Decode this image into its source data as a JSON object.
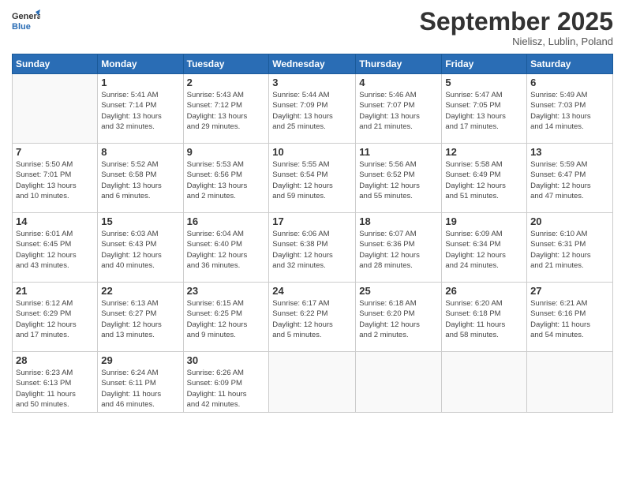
{
  "logo": {
    "line1": "General",
    "line2": "Blue"
  },
  "title": "September 2025",
  "subtitle": "Nielisz, Lublin, Poland",
  "weekdays": [
    "Sunday",
    "Monday",
    "Tuesday",
    "Wednesday",
    "Thursday",
    "Friday",
    "Saturday"
  ],
  "days": [
    {
      "date": "",
      "info": ""
    },
    {
      "date": "1",
      "info": "Sunrise: 5:41 AM\nSunset: 7:14 PM\nDaylight: 13 hours\nand 32 minutes."
    },
    {
      "date": "2",
      "info": "Sunrise: 5:43 AM\nSunset: 7:12 PM\nDaylight: 13 hours\nand 29 minutes."
    },
    {
      "date": "3",
      "info": "Sunrise: 5:44 AM\nSunset: 7:09 PM\nDaylight: 13 hours\nand 25 minutes."
    },
    {
      "date": "4",
      "info": "Sunrise: 5:46 AM\nSunset: 7:07 PM\nDaylight: 13 hours\nand 21 minutes."
    },
    {
      "date": "5",
      "info": "Sunrise: 5:47 AM\nSunset: 7:05 PM\nDaylight: 13 hours\nand 17 minutes."
    },
    {
      "date": "6",
      "info": "Sunrise: 5:49 AM\nSunset: 7:03 PM\nDaylight: 13 hours\nand 14 minutes."
    },
    {
      "date": "7",
      "info": "Sunrise: 5:50 AM\nSunset: 7:01 PM\nDaylight: 13 hours\nand 10 minutes."
    },
    {
      "date": "8",
      "info": "Sunrise: 5:52 AM\nSunset: 6:58 PM\nDaylight: 13 hours\nand 6 minutes."
    },
    {
      "date": "9",
      "info": "Sunrise: 5:53 AM\nSunset: 6:56 PM\nDaylight: 13 hours\nand 2 minutes."
    },
    {
      "date": "10",
      "info": "Sunrise: 5:55 AM\nSunset: 6:54 PM\nDaylight: 12 hours\nand 59 minutes."
    },
    {
      "date": "11",
      "info": "Sunrise: 5:56 AM\nSunset: 6:52 PM\nDaylight: 12 hours\nand 55 minutes."
    },
    {
      "date": "12",
      "info": "Sunrise: 5:58 AM\nSunset: 6:49 PM\nDaylight: 12 hours\nand 51 minutes."
    },
    {
      "date": "13",
      "info": "Sunrise: 5:59 AM\nSunset: 6:47 PM\nDaylight: 12 hours\nand 47 minutes."
    },
    {
      "date": "14",
      "info": "Sunrise: 6:01 AM\nSunset: 6:45 PM\nDaylight: 12 hours\nand 43 minutes."
    },
    {
      "date": "15",
      "info": "Sunrise: 6:03 AM\nSunset: 6:43 PM\nDaylight: 12 hours\nand 40 minutes."
    },
    {
      "date": "16",
      "info": "Sunrise: 6:04 AM\nSunset: 6:40 PM\nDaylight: 12 hours\nand 36 minutes."
    },
    {
      "date": "17",
      "info": "Sunrise: 6:06 AM\nSunset: 6:38 PM\nDaylight: 12 hours\nand 32 minutes."
    },
    {
      "date": "18",
      "info": "Sunrise: 6:07 AM\nSunset: 6:36 PM\nDaylight: 12 hours\nand 28 minutes."
    },
    {
      "date": "19",
      "info": "Sunrise: 6:09 AM\nSunset: 6:34 PM\nDaylight: 12 hours\nand 24 minutes."
    },
    {
      "date": "20",
      "info": "Sunrise: 6:10 AM\nSunset: 6:31 PM\nDaylight: 12 hours\nand 21 minutes."
    },
    {
      "date": "21",
      "info": "Sunrise: 6:12 AM\nSunset: 6:29 PM\nDaylight: 12 hours\nand 17 minutes."
    },
    {
      "date": "22",
      "info": "Sunrise: 6:13 AM\nSunset: 6:27 PM\nDaylight: 12 hours\nand 13 minutes."
    },
    {
      "date": "23",
      "info": "Sunrise: 6:15 AM\nSunset: 6:25 PM\nDaylight: 12 hours\nand 9 minutes."
    },
    {
      "date": "24",
      "info": "Sunrise: 6:17 AM\nSunset: 6:22 PM\nDaylight: 12 hours\nand 5 minutes."
    },
    {
      "date": "25",
      "info": "Sunrise: 6:18 AM\nSunset: 6:20 PM\nDaylight: 12 hours\nand 2 minutes."
    },
    {
      "date": "26",
      "info": "Sunrise: 6:20 AM\nSunset: 6:18 PM\nDaylight: 11 hours\nand 58 minutes."
    },
    {
      "date": "27",
      "info": "Sunrise: 6:21 AM\nSunset: 6:16 PM\nDaylight: 11 hours\nand 54 minutes."
    },
    {
      "date": "28",
      "info": "Sunrise: 6:23 AM\nSunset: 6:13 PM\nDaylight: 11 hours\nand 50 minutes."
    },
    {
      "date": "29",
      "info": "Sunrise: 6:24 AM\nSunset: 6:11 PM\nDaylight: 11 hours\nand 46 minutes."
    },
    {
      "date": "30",
      "info": "Sunrise: 6:26 AM\nSunset: 6:09 PM\nDaylight: 11 hours\nand 42 minutes."
    },
    {
      "date": "",
      "info": ""
    },
    {
      "date": "",
      "info": ""
    },
    {
      "date": "",
      "info": ""
    },
    {
      "date": "",
      "info": ""
    }
  ]
}
